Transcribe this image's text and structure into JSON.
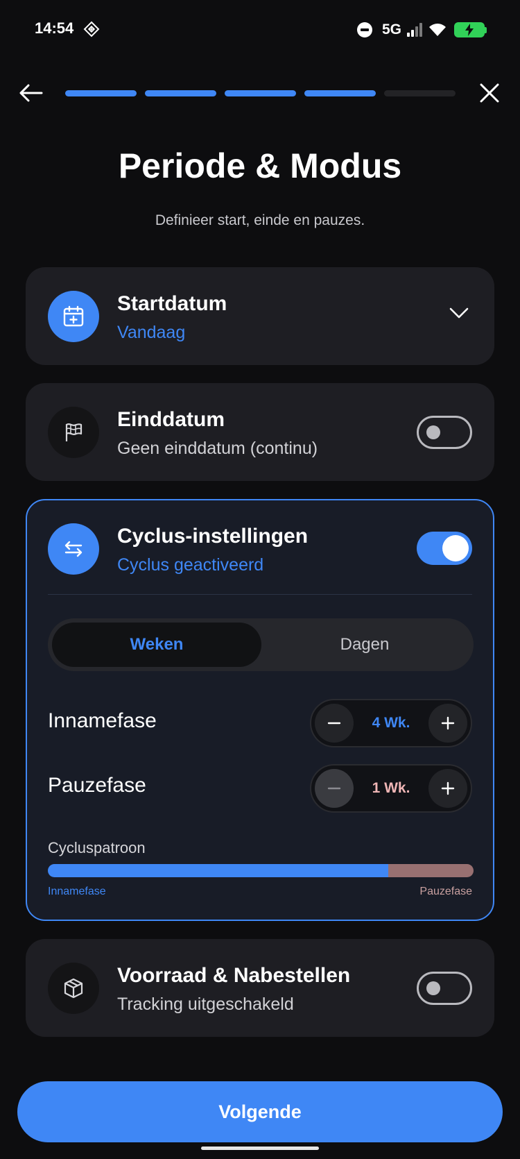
{
  "status_bar": {
    "time": "14:54",
    "network": "5G",
    "battery_color": "#31d158"
  },
  "header": {
    "progress": {
      "total_steps": 5,
      "completed_steps": 4
    },
    "title": "Periode & Modus",
    "subtitle": "Definieer start, einde en pauzes."
  },
  "start_card": {
    "icon": "calendar-plus-icon",
    "title": "Startdatum",
    "value": "Vandaag"
  },
  "end_card": {
    "icon": "flag-icon",
    "title": "Einddatum",
    "value": "Geen einddatum (continu)",
    "enabled": false
  },
  "cycle_card": {
    "icon": "swap-arrows-icon",
    "title": "Cyclus-instellingen",
    "status": "Cyclus geactiveerd",
    "enabled": true,
    "units": [
      "Weken",
      "Dagen"
    ],
    "selected_unit": "Weken",
    "intake": {
      "label": "Innamefase",
      "value": "4 Wk.",
      "count": 4
    },
    "pause": {
      "label": "Pauzefase",
      "value": "1 Wk.",
      "count": 1
    },
    "pattern": {
      "label": "Cycluspatroon",
      "left_label": "Innamefase",
      "right_label": "Pauzefase",
      "intake_fraction": 0.8
    }
  },
  "stock_card": {
    "icon": "package-icon",
    "title": "Voorraad & Nabestellen",
    "value": "Tracking uitgeschakeld",
    "enabled": false
  },
  "footer": {
    "next_label": "Volgende"
  },
  "colors": {
    "accent": "#3f87f5",
    "background": "#0d0d0f",
    "card": "#1e1e23",
    "pause_color": "#987071",
    "pause_text": "#f0b6b6"
  }
}
